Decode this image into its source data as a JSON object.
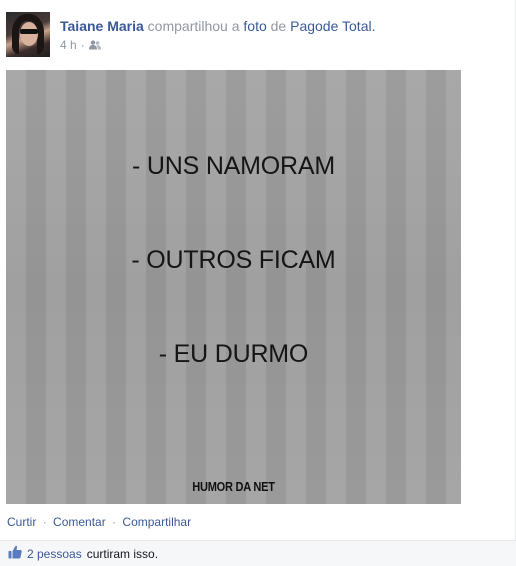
{
  "post": {
    "author": "Taiane Maria",
    "action_text": "compartilhou a",
    "object_link": "foto",
    "preposition": "de",
    "source_page": "Pagode Total.",
    "time": "4 h",
    "audience_icon": "friends-icon"
  },
  "photo": {
    "lines": [
      "- UNS NAMORAM",
      "- OUTROS FICAM",
      "- EU DURMO"
    ],
    "credit": "HUMOR DA NET"
  },
  "actions": {
    "like": "Curtir",
    "comment": "Comentar",
    "share": "Compartilhar",
    "separator": "·"
  },
  "likes": {
    "icon": "thumbs-up-icon",
    "count_text": "2 pessoas",
    "suffix": "curtiram isso."
  },
  "colors": {
    "link": "#3b5998",
    "meta_gray": "#9197a3",
    "likes_bg": "#f6f7f9"
  }
}
